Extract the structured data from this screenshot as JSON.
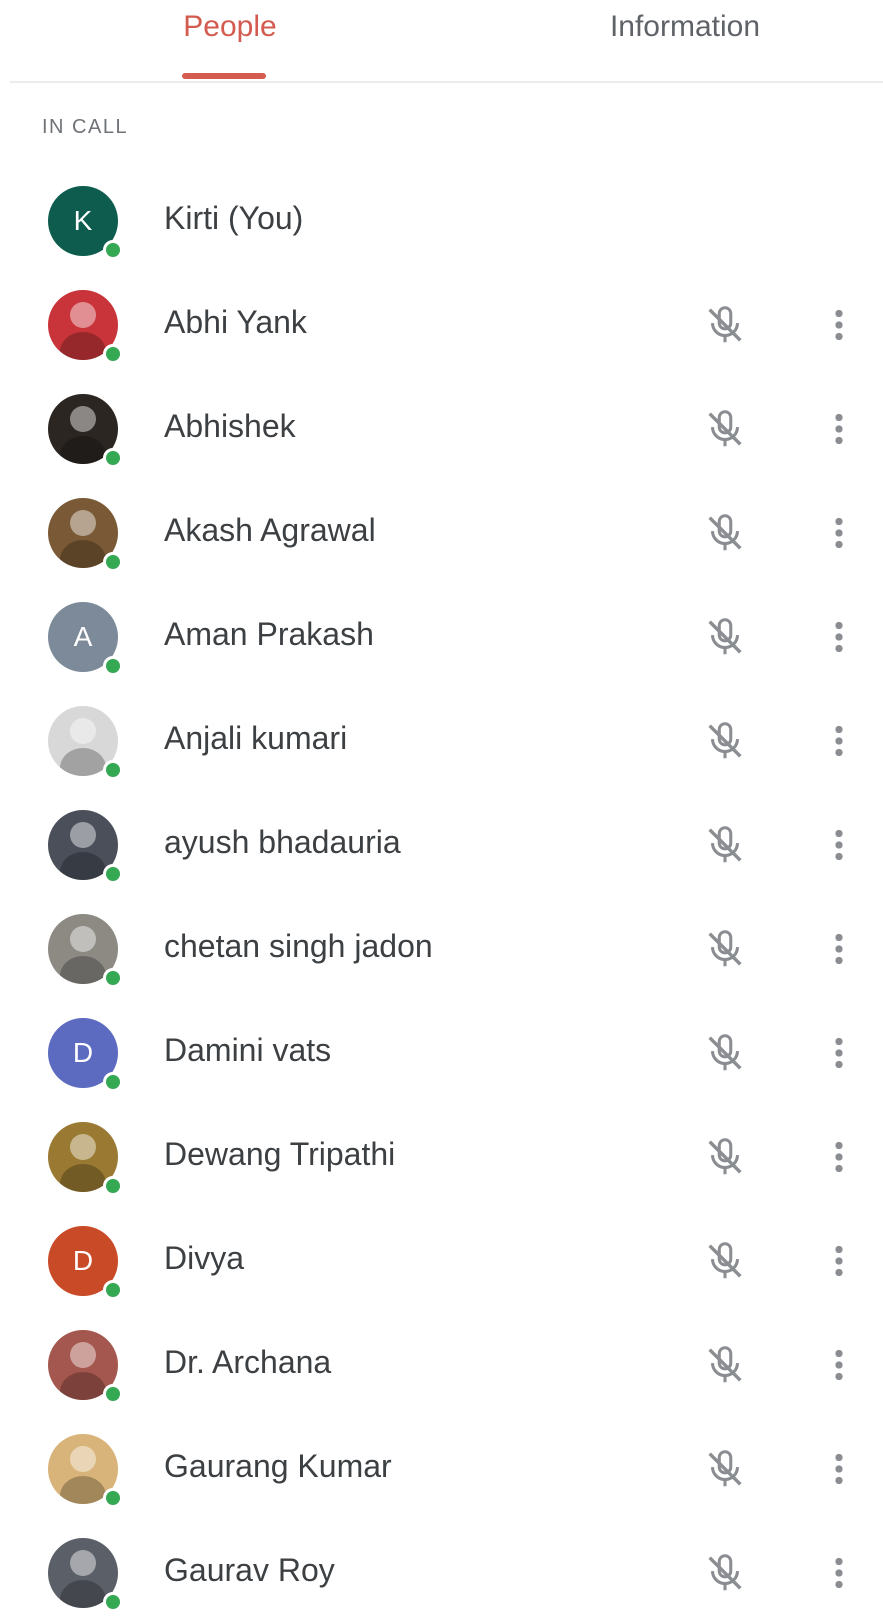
{
  "tabs": {
    "people": "People",
    "information": "Information",
    "active": "people",
    "accent_color": "#d35b4f"
  },
  "section": {
    "header": "IN CALL"
  },
  "status_color": "#34a853",
  "participants": [
    {
      "name": "Kirti (You)",
      "avatar": {
        "type": "initial",
        "initial": "K",
        "color": "#0d5c4e"
      },
      "muted": false,
      "show_actions": false
    },
    {
      "name": "Abhi Yank",
      "avatar": {
        "type": "photo",
        "color": "#c8343a"
      },
      "muted": true,
      "show_actions": true
    },
    {
      "name": "Abhishek",
      "avatar": {
        "type": "photo",
        "color": "#2b2622"
      },
      "muted": true,
      "show_actions": true
    },
    {
      "name": "Akash Agrawal",
      "avatar": {
        "type": "photo",
        "color": "#7a5a36"
      },
      "muted": true,
      "show_actions": true
    },
    {
      "name": "Aman Prakash",
      "avatar": {
        "type": "initial",
        "initial": "A",
        "color": "#7c8a9a"
      },
      "muted": true,
      "show_actions": true
    },
    {
      "name": "Anjali kumari",
      "avatar": {
        "type": "photo",
        "color": "#d8d8d8"
      },
      "muted": true,
      "show_actions": true
    },
    {
      "name": "ayush bhadauria",
      "avatar": {
        "type": "photo",
        "color": "#4a4f5a"
      },
      "muted": true,
      "show_actions": true
    },
    {
      "name": "chetan singh jadon",
      "avatar": {
        "type": "photo",
        "color": "#8d8a84"
      },
      "muted": true,
      "show_actions": true
    },
    {
      "name": "Damini vats",
      "avatar": {
        "type": "initial",
        "initial": "D",
        "color": "#5c6bc0"
      },
      "muted": true,
      "show_actions": true
    },
    {
      "name": "Dewang Tripathi",
      "avatar": {
        "type": "photo",
        "color": "#9a7a32"
      },
      "muted": true,
      "show_actions": true
    },
    {
      "name": "Divya",
      "avatar": {
        "type": "initial",
        "initial": "D",
        "color": "#c84a26"
      },
      "muted": true,
      "show_actions": true
    },
    {
      "name": "Dr. Archana",
      "avatar": {
        "type": "photo",
        "color": "#a4574e"
      },
      "muted": true,
      "show_actions": true
    },
    {
      "name": "Gaurang Kumar",
      "avatar": {
        "type": "photo",
        "color": "#d9b47a"
      },
      "muted": true,
      "show_actions": true
    },
    {
      "name": "Gaurav Roy",
      "avatar": {
        "type": "photo",
        "color": "#5b6068"
      },
      "muted": true,
      "show_actions": true
    }
  ]
}
